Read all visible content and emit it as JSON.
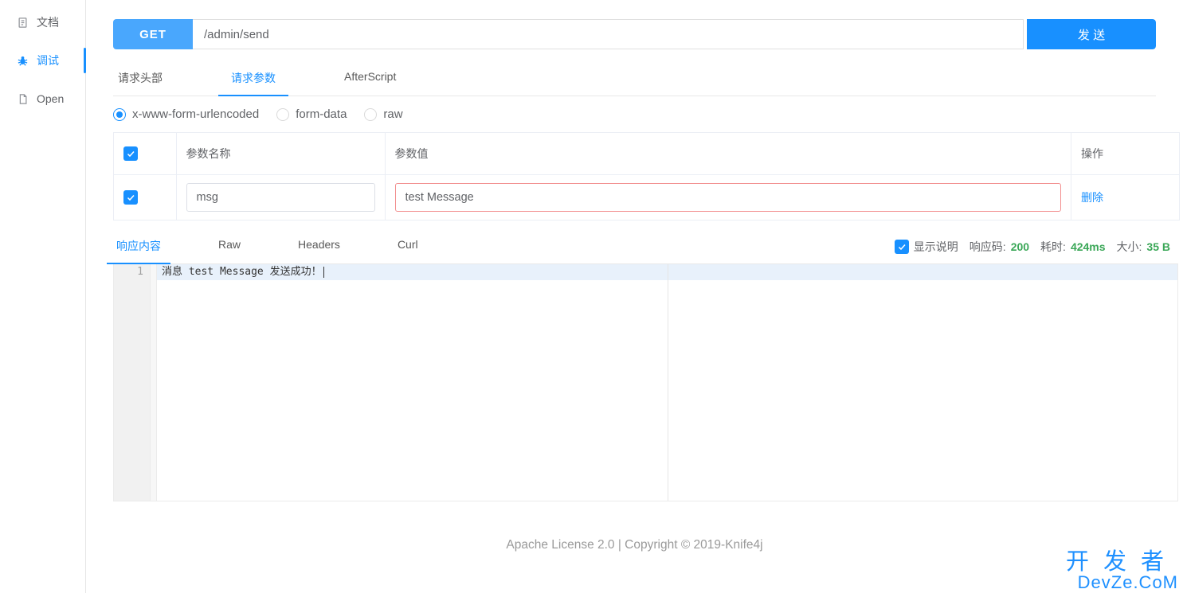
{
  "sidebar": {
    "items": [
      {
        "id": "doc",
        "label": "文档",
        "icon": "document-icon",
        "active": false
      },
      {
        "id": "debug",
        "label": "调试",
        "icon": "bug-icon",
        "active": true
      },
      {
        "id": "open",
        "label": "Open",
        "icon": "page-icon",
        "active": false
      }
    ]
  },
  "request": {
    "method": "GET",
    "url": "/admin/send",
    "send_label": "发 送"
  },
  "req_tabs": [
    {
      "id": "headers",
      "label": "请求头部",
      "active": false
    },
    {
      "id": "params",
      "label": "请求参数",
      "active": true
    },
    {
      "id": "after",
      "label": "AfterScript",
      "active": false
    }
  ],
  "body_types": [
    {
      "id": "urlenc",
      "label": "x-www-form-urlencoded",
      "checked": true
    },
    {
      "id": "form",
      "label": "form-data",
      "checked": false
    },
    {
      "id": "raw",
      "label": "raw",
      "checked": false
    }
  ],
  "params_table": {
    "headers": {
      "name": "参数名称",
      "value": "参数值",
      "ops": "操作"
    },
    "rows": [
      {
        "checked": true,
        "name": "msg",
        "value": "test Message",
        "value_invalid": true,
        "delete_label": "删除"
      }
    ]
  },
  "result_tabs": [
    {
      "id": "body",
      "label": "响应内容",
      "active": true
    },
    {
      "id": "raw",
      "label": "Raw",
      "active": false
    },
    {
      "id": "hdr",
      "label": "Headers",
      "active": false
    },
    {
      "id": "curl",
      "label": "Curl",
      "active": false
    }
  ],
  "result_meta": {
    "show_desc_label": "显示说明",
    "show_desc_checked": true,
    "status_label": "响应码:",
    "status_value": "200",
    "time_label": "耗时:",
    "time_value": "424ms",
    "size_label": "大小:",
    "size_value": "35 B"
  },
  "response_body": {
    "line_no": "1",
    "text": "消息 test Message 发送成功！"
  },
  "footer": "Apache License 2.0 | Copyright © 2019-Knife4j",
  "watermark": {
    "top": "开发者",
    "bottom": "DevZe.CoM"
  }
}
